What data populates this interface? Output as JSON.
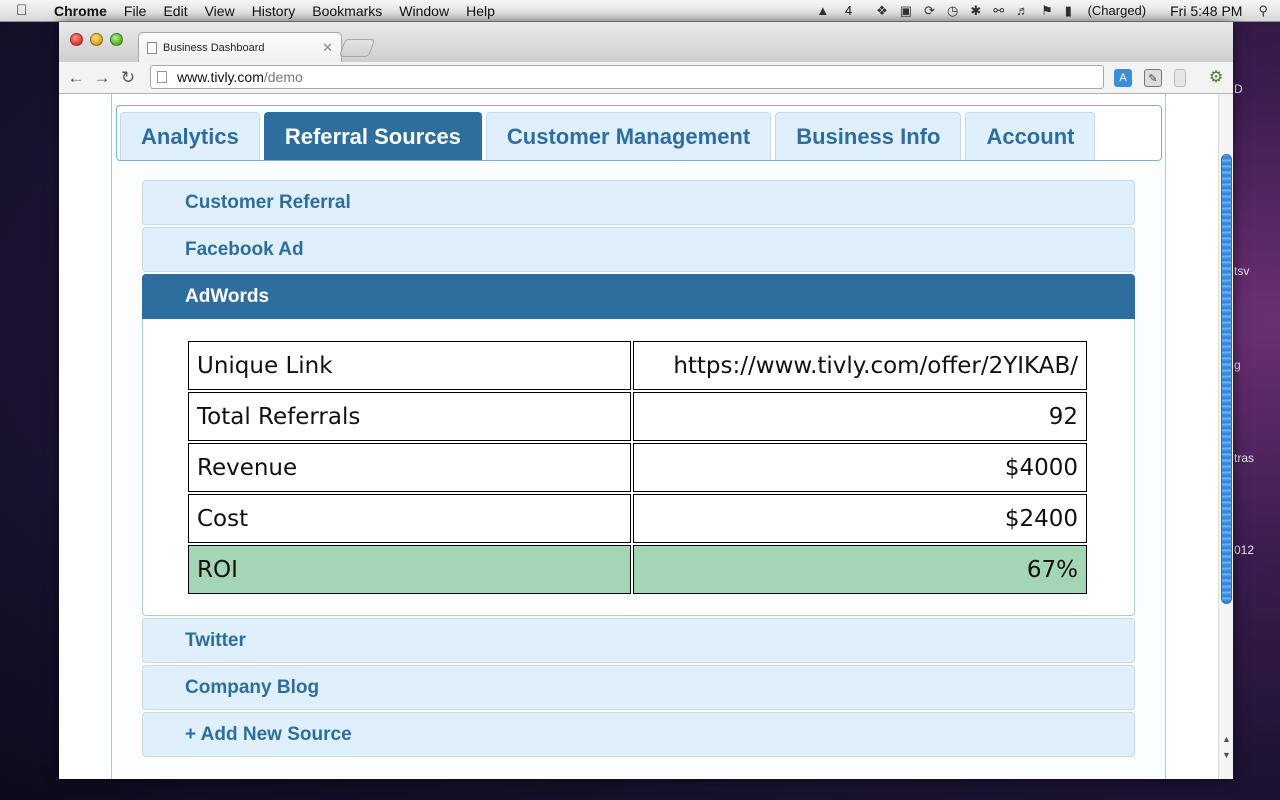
{
  "menubar": {
    "items": [
      "Chrome",
      "File",
      "Edit",
      "View",
      "History",
      "Bookmarks",
      "Window",
      "Help"
    ],
    "status": {
      "adobe_count": "4",
      "battery": "(Charged)",
      "clock": "Fri 5:48 PM"
    }
  },
  "desktop": {
    "labels": [
      "D",
      "tsv",
      "g",
      "tras",
      "012"
    ]
  },
  "browser": {
    "tab_title": "Business Dashboard",
    "url_host": "www.tivly.com",
    "url_path": "/demo"
  },
  "app": {
    "tabs": [
      {
        "label": "Analytics"
      },
      {
        "label": "Referral Sources"
      },
      {
        "label": "Customer Management"
      },
      {
        "label": "Business Info"
      },
      {
        "label": "Account"
      }
    ],
    "active_tab": "Referral Sources",
    "sources": [
      {
        "label": "Customer Referral"
      },
      {
        "label": "Facebook Ad"
      },
      {
        "label": "AdWords"
      },
      {
        "label": "Twitter"
      },
      {
        "label": "Company Blog"
      },
      {
        "label": "+ Add New Source"
      }
    ],
    "active_source": "AdWords",
    "stats": {
      "unique_link": {
        "label": "Unique Link",
        "value": "https://www.tivly.com/offer/2YIKAB/"
      },
      "total_referrals": {
        "label": "Total Referrals",
        "value": "92"
      },
      "revenue": {
        "label": "Revenue",
        "value": "$4000"
      },
      "cost": {
        "label": "Cost",
        "value": "$2400"
      },
      "roi": {
        "label": "ROI",
        "value": "67%"
      }
    }
  },
  "colors": {
    "accent": "#2e6e9e",
    "tab_bg": "#dfeffc",
    "roi_highlight": "#a3d6b4"
  }
}
